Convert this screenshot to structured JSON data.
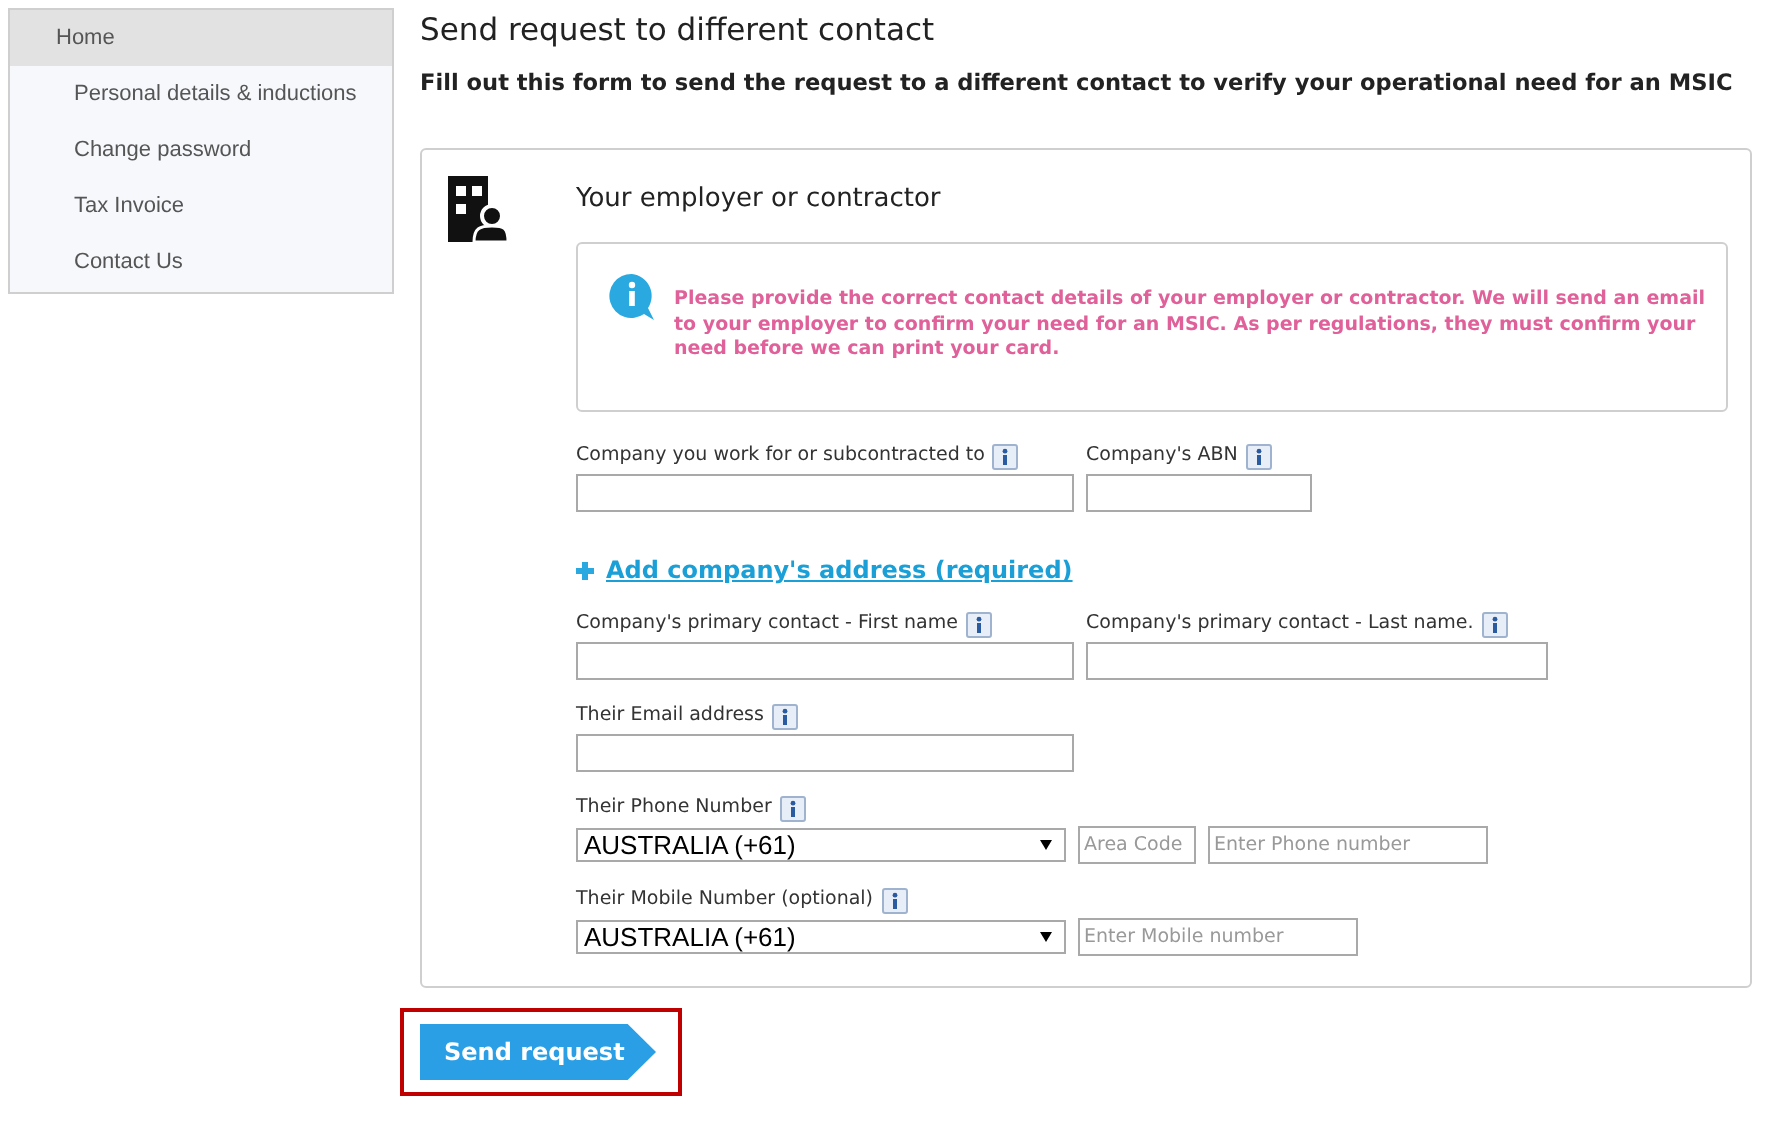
{
  "sidebar": {
    "items": [
      {
        "label": "Home",
        "selected": true
      },
      {
        "label": "Personal details & inductions",
        "selected": false
      },
      {
        "label": "Change password",
        "selected": false
      },
      {
        "label": "Tax Invoice",
        "selected": false
      },
      {
        "label": "Contact Us",
        "selected": false
      }
    ]
  },
  "page": {
    "title": "Send request to different contact",
    "subtitle": "Fill out this form to send the request to a different contact to verify your operational need for an MSIC"
  },
  "card": {
    "title": "Your employer or contractor",
    "notice": "Please provide the correct contact details of your employer or contractor. We will send an email to your employer to confirm your need for an MSIC. As per regulations, they must confirm your need before we can print your card.",
    "sections": [
      {
        "kind": "fields",
        "fields": [
          {
            "label": "Company you work for or subcontracted to",
            "controls": [
              {
                "kind": "text"
              }
            ]
          },
          {
            "label": "Company's ABN",
            "controls": [
              {
                "kind": "text"
              }
            ]
          }
        ]
      },
      {
        "kind": "link",
        "label": "Add company's address (required)"
      },
      {
        "kind": "fields",
        "fields": [
          {
            "label": "Company's primary contact - First name",
            "controls": [
              {
                "kind": "text"
              }
            ]
          },
          {
            "label": "Company's primary contact - Last name.",
            "controls": [
              {
                "kind": "text"
              }
            ]
          }
        ]
      },
      {
        "kind": "fields",
        "fields": [
          {
            "label": "Their Email address",
            "controls": [
              {
                "kind": "text"
              }
            ]
          }
        ]
      },
      {
        "kind": "fields",
        "fields": [
          {
            "label": "Their Phone Number",
            "controls": [
              {
                "kind": "select",
                "value": "AUSTRALIA (+61)"
              },
              {
                "kind": "text",
                "placeholder": "Area Code"
              },
              {
                "kind": "text",
                "placeholder": "Enter Phone number"
              }
            ]
          }
        ]
      },
      {
        "kind": "fields",
        "fields": [
          {
            "label": "Their Mobile Number (optional)",
            "controls": [
              {
                "kind": "select",
                "value": "AUSTRALIA (+61)"
              },
              {
                "kind": "text",
                "placeholder": "Enter Mobile number"
              }
            ]
          }
        ]
      }
    ]
  },
  "submit": {
    "label": "Send request",
    "highlighted": true
  }
}
